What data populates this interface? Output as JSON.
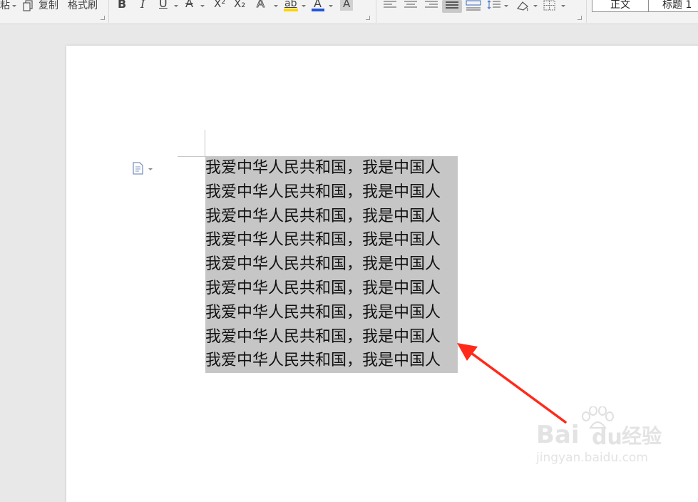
{
  "toolbar": {
    "paste_label": "粘",
    "copy_label": "复制",
    "format_painter_label": "格式刷",
    "bold_glyph": "B",
    "italic_glyph": "I",
    "underline_glyph": "U",
    "font_color_glyph": "A",
    "superscript_glyph": "X²",
    "subscript_glyph": "X₂",
    "text_effect_glyph": "A",
    "highlight_glyph": "ab",
    "char_color_glyph": "A",
    "char_shading_glyph": "A",
    "styles": [
      {
        "label": "正文"
      },
      {
        "label": "标题 1"
      }
    ]
  },
  "document": {
    "lines": [
      "我爱中华人民共和国，我是中国人",
      "我爱中华人民共和国，我是中国人",
      "我爱中华人民共和国，我是中国人",
      "我爱中华人民共和国，我是中国人",
      "我爱中华人民共和国，我是中国人",
      "我爱中华人民共和国，我是中国人",
      "我爱中华人民共和国，我是中国人",
      "我爱中华人民共和国，我是中国人",
      "我爱中华人民共和国，我是中国人"
    ]
  },
  "watermark": {
    "brand": "Bai",
    "brand_tail": "du",
    "product": "经验",
    "url": "jingyan.baidu.com"
  },
  "colors": {
    "selection": "#c6c6c6",
    "annotation_arrow": "#ff2a1a",
    "highlight_swatch": "#ffd400",
    "font_color_swatch": "#e02020",
    "char_color_swatch": "#2255dd"
  }
}
